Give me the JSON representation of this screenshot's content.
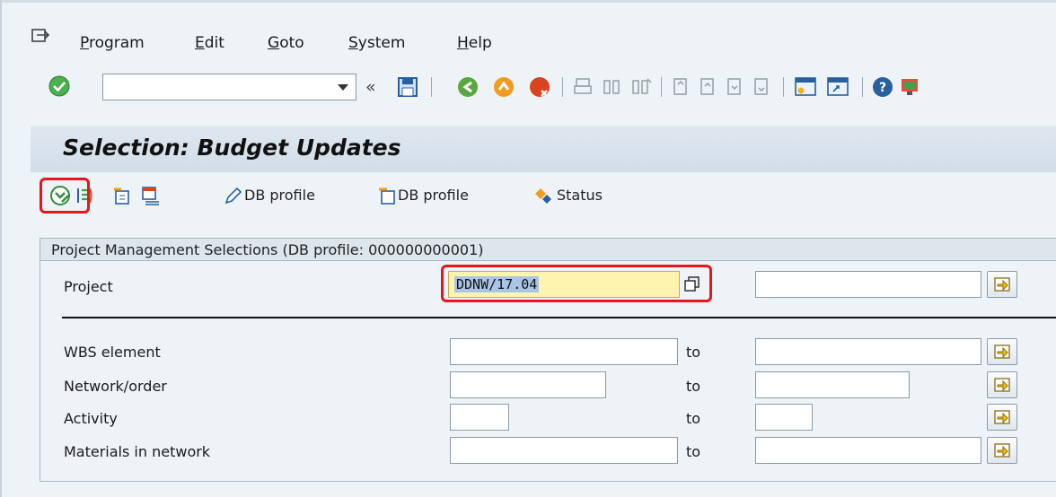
{
  "menu": {
    "items": [
      "Program",
      "Edit",
      "Goto",
      "System",
      "Help"
    ]
  },
  "toolbar": {
    "command_value": "",
    "back_label": "«"
  },
  "screen": {
    "title": "Selection: Budget Updates"
  },
  "app_toolbar": {
    "db_profile_1": "DB profile",
    "db_profile_2": "DB profile",
    "status": "Status"
  },
  "group": {
    "title": "Project Management Selections (DB profile: 000000000001)"
  },
  "fields": {
    "project": {
      "label": "Project",
      "value": "DDNW/17.04"
    },
    "wbs": {
      "label": "WBS element",
      "to": "to"
    },
    "network": {
      "label": "Network/order",
      "to": "to"
    },
    "activity": {
      "label": "Activity",
      "to": "to"
    },
    "materials": {
      "label": "Materials in network",
      "to": "to"
    }
  },
  "colors": {
    "highlight_red": "#e8161c",
    "project_field_yellow": "#fff3b0",
    "arrow_button_yellow": "#f5c400"
  }
}
